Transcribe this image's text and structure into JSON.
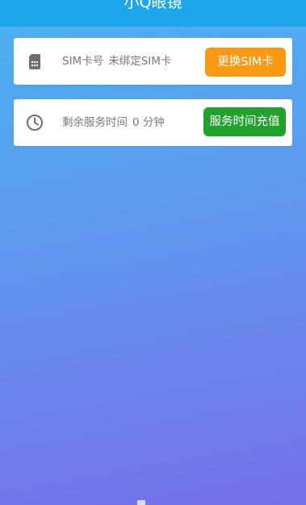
{
  "app": {
    "title": "小Q眼镜"
  },
  "sim_card": {
    "icon": "sim-card-icon",
    "label": "SIM卡号",
    "value": "未绑定SIM卡",
    "button_label": "更换SIM卡",
    "button_color": "#fa9a14"
  },
  "service_time": {
    "icon": "clock-icon",
    "label": "剩余服务时间",
    "value": "0 分钟",
    "button_label": "服务时间充值",
    "button_color": "#23a12f"
  },
  "colors": {
    "topbar": "#1ea6ec",
    "gradient_start": "#4ab1f1",
    "gradient_end": "#7670ea"
  }
}
